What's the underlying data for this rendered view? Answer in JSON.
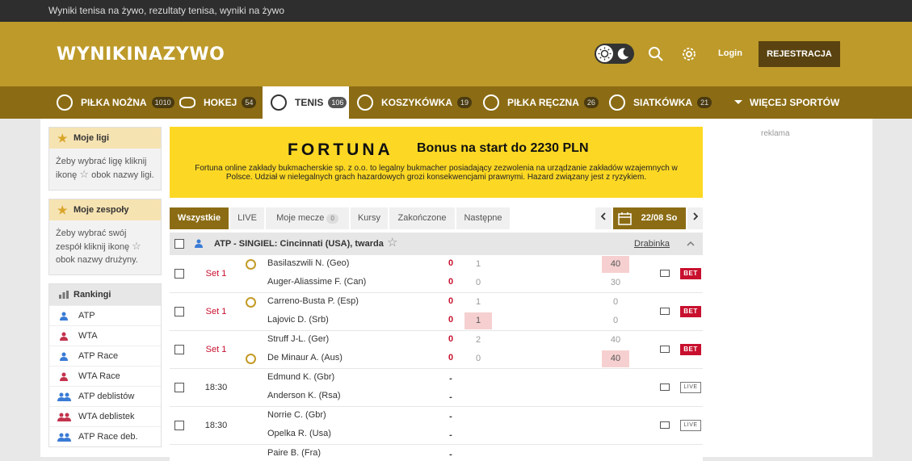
{
  "top_banner": "Wyniki tenisa na żywo, rezultaty tenisa, wyniki na żywo",
  "header": {
    "logo": "WYNIKINAZYWO",
    "login": "Login",
    "register": "REJESTRACJA"
  },
  "sports": [
    {
      "label": "PIŁKA NOŻNA",
      "count": "1010",
      "icon": "soccer-ball-icon"
    },
    {
      "label": "HOKEJ",
      "count": "54",
      "icon": "hockey-puck-icon"
    },
    {
      "label": "TENIS",
      "count": "106",
      "icon": "tennis-ball-icon",
      "active": true
    },
    {
      "label": "KOSZYKÓWKA",
      "count": "19",
      "icon": "basketball-icon"
    },
    {
      "label": "PIŁKA RĘCZNA",
      "count": "26",
      "icon": "handball-icon"
    },
    {
      "label": "SIATKÓWKA",
      "count": "21",
      "icon": "volleyball-icon"
    },
    {
      "label": "WIĘCEJ SPORTÓW",
      "icon": "chevron-down-icon"
    }
  ],
  "sidebar": {
    "my_leagues": {
      "title": "Moje ligi",
      "text_before": "Żeby wybrać ligę kliknij ikonę",
      "text_after": "obok nazwy ligi."
    },
    "my_teams": {
      "title": "Moje zespoły",
      "text_before": "Żeby wybrać swój zespół kliknij ikonę",
      "text_after": "obok nazwy drużyny."
    },
    "rankings": {
      "title": "Rankingi",
      "items": [
        "ATP",
        "WTA",
        "ATP Race",
        "WTA Race",
        "ATP deblistów",
        "WTA deblistek",
        "ATP Race deb."
      ]
    }
  },
  "banner": {
    "brand": "FORTUNA",
    "bonus": "Bonus na start do 2230 PLN",
    "disclaimer": "Fortuna online zakłady bukmacherskie sp. z o.o. to legalny bukmacher posiadający zezwolenia na urządzanie zakładów wzajemnych w Polsce. Udział w nielegalnych grach hazardowych grozi konsekwencjami prawnymi. Hazard związany jest z ryzykiem."
  },
  "tabs": {
    "all": "Wszystkie",
    "live": "LIVE",
    "my_matches": "Moje mecze",
    "my_matches_count": "0",
    "odds": "Kursy",
    "finished": "Zakończone",
    "next": "Następne",
    "date": "22/08 So"
  },
  "league": {
    "name": "ATP - SINGIEL: Cincinnati (USA), twarda",
    "draw": "Drabinka"
  },
  "ad": "reklama",
  "matches": [
    {
      "stage": "Set 1",
      "live": true,
      "home": "Basilaszwili N. (Geo)",
      "away": "Auger-Aliassime F. (Can)",
      "home_score": "0",
      "away_score": "0",
      "home_set": "1",
      "away_set": "0",
      "home_pts": "40",
      "away_pts": "30",
      "serve": "home",
      "hl_set": "",
      "hl_pts": "home",
      "action": "BET"
    },
    {
      "stage": "Set 1",
      "live": true,
      "home": "Carreno-Busta P. (Esp)",
      "away": "Lajovic D. (Srb)",
      "home_score": "0",
      "away_score": "0",
      "home_set": "1",
      "away_set": "1",
      "home_pts": "0",
      "away_pts": "0",
      "serve": "home",
      "hl_set": "away",
      "hl_pts": "",
      "action": "BET"
    },
    {
      "stage": "Set 1",
      "live": true,
      "home": "Struff J-L. (Ger)",
      "away": "De Minaur A. (Aus)",
      "home_score": "0",
      "away_score": "0",
      "home_set": "2",
      "away_set": "0",
      "home_pts": "40",
      "away_pts": "40",
      "serve": "away",
      "hl_set": "",
      "hl_pts": "away",
      "action": "BET"
    },
    {
      "stage": "18:30",
      "live": false,
      "home": "Edmund K. (Gbr)",
      "away": "Anderson K. (Rsa)",
      "home_score": "-",
      "away_score": "-",
      "action": "LIVE"
    },
    {
      "stage": "18:30",
      "live": false,
      "home": "Norrie C. (Gbr)",
      "away": "Opelka R. (Usa)",
      "home_score": "-",
      "away_score": "-",
      "action": "LIVE"
    },
    {
      "stage": "",
      "live": false,
      "home": "Paire B. (Fra)",
      "away": "",
      "home_score": "-",
      "away_score": "",
      "action": ""
    }
  ]
}
